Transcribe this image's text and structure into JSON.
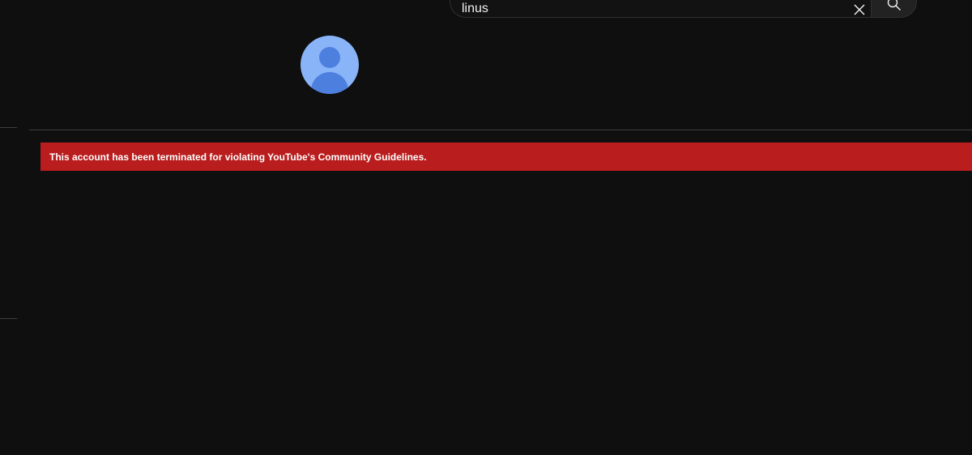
{
  "search": {
    "query": "linus",
    "clear_icon": "close-icon",
    "search_icon": "search-icon"
  },
  "channel": {
    "avatar_icon": "default-avatar-icon"
  },
  "alert": {
    "message": "This account has been terminated for violating YouTube's Community Guidelines.",
    "color": "#b91d1d"
  },
  "theme": {
    "background": "#0f0f0f",
    "avatar_bg": "#89b4f8",
    "avatar_fg": "#4d7fdf"
  }
}
